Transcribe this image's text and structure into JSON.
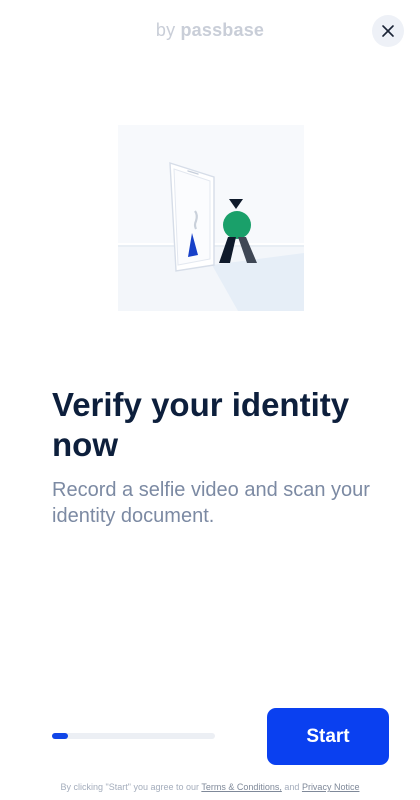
{
  "brand": {
    "by": "by",
    "name": "passbase"
  },
  "header": {
    "close_icon": "close-icon"
  },
  "illustration": {
    "description_icon": "selfie-verification-illustration",
    "accent": "#1aa06a"
  },
  "main": {
    "title": "Verify your identity now",
    "subtitle": "Record a selfie video and scan your identity document."
  },
  "progress": {
    "fraction": 0.1,
    "color": "#1146e8"
  },
  "actions": {
    "start_label": "Start",
    "start_color": "#0a40f0"
  },
  "legal": {
    "prefix": "By clicking \"Start\" you agree to our",
    "terms_label": "Terms & Conditions,",
    "and": "and",
    "privacy_label": "Privacy Notice"
  }
}
